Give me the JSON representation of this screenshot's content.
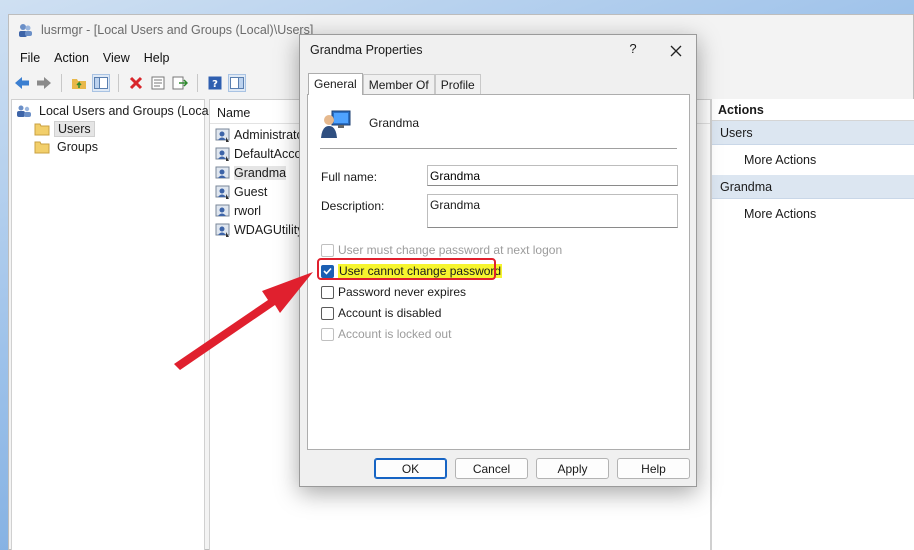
{
  "window": {
    "title": "lusrmgr - [Local Users and Groups (Local)\\Users]",
    "menu": [
      "File",
      "Action",
      "View",
      "Help"
    ]
  },
  "tree": {
    "root": "Local Users and Groups (Local)",
    "items": [
      {
        "label": "Users",
        "selected": true
      },
      {
        "label": "Groups",
        "selected": false
      }
    ]
  },
  "list": {
    "column_header": "Name",
    "rows": [
      {
        "name": "Administrator",
        "selected": false
      },
      {
        "name": "DefaultAcco...",
        "selected": false
      },
      {
        "name": "Grandma",
        "selected": true
      },
      {
        "name": "Guest",
        "selected": false
      },
      {
        "name": "rworl",
        "selected": false
      },
      {
        "name": "WDAGUtility",
        "selected": false
      }
    ]
  },
  "actions": {
    "header": "Actions",
    "groups": [
      {
        "label": "Users",
        "item": "More Actions"
      },
      {
        "label": "Grandma",
        "item": "More Actions"
      }
    ]
  },
  "dialog": {
    "title": "Grandma Properties",
    "help_glyph": "?",
    "tabs": [
      {
        "label": "General",
        "active": true
      },
      {
        "label": "Member Of",
        "active": false
      },
      {
        "label": "Profile",
        "active": false
      }
    ],
    "user_heading": "Grandma",
    "full_name_label": "Full name:",
    "full_name_value": "Grandma",
    "description_label": "Description:",
    "description_value": "Grandma",
    "checkboxes": [
      {
        "label": "User must change password at next logon",
        "checked": false,
        "enabled": false
      },
      {
        "label": "User cannot change password",
        "checked": true,
        "enabled": true
      },
      {
        "label": "Password never expires",
        "checked": false,
        "enabled": true
      },
      {
        "label": "Account is disabled",
        "checked": false,
        "enabled": true
      },
      {
        "label": "Account is locked out",
        "checked": false,
        "enabled": false
      }
    ],
    "buttons": {
      "ok": "OK",
      "cancel": "Cancel",
      "apply": "Apply",
      "help": "Help"
    }
  },
  "annotation": {
    "highlight_color": "#f6f52e",
    "box_color": "#e0202e",
    "arrow_color": "#e0202e"
  }
}
